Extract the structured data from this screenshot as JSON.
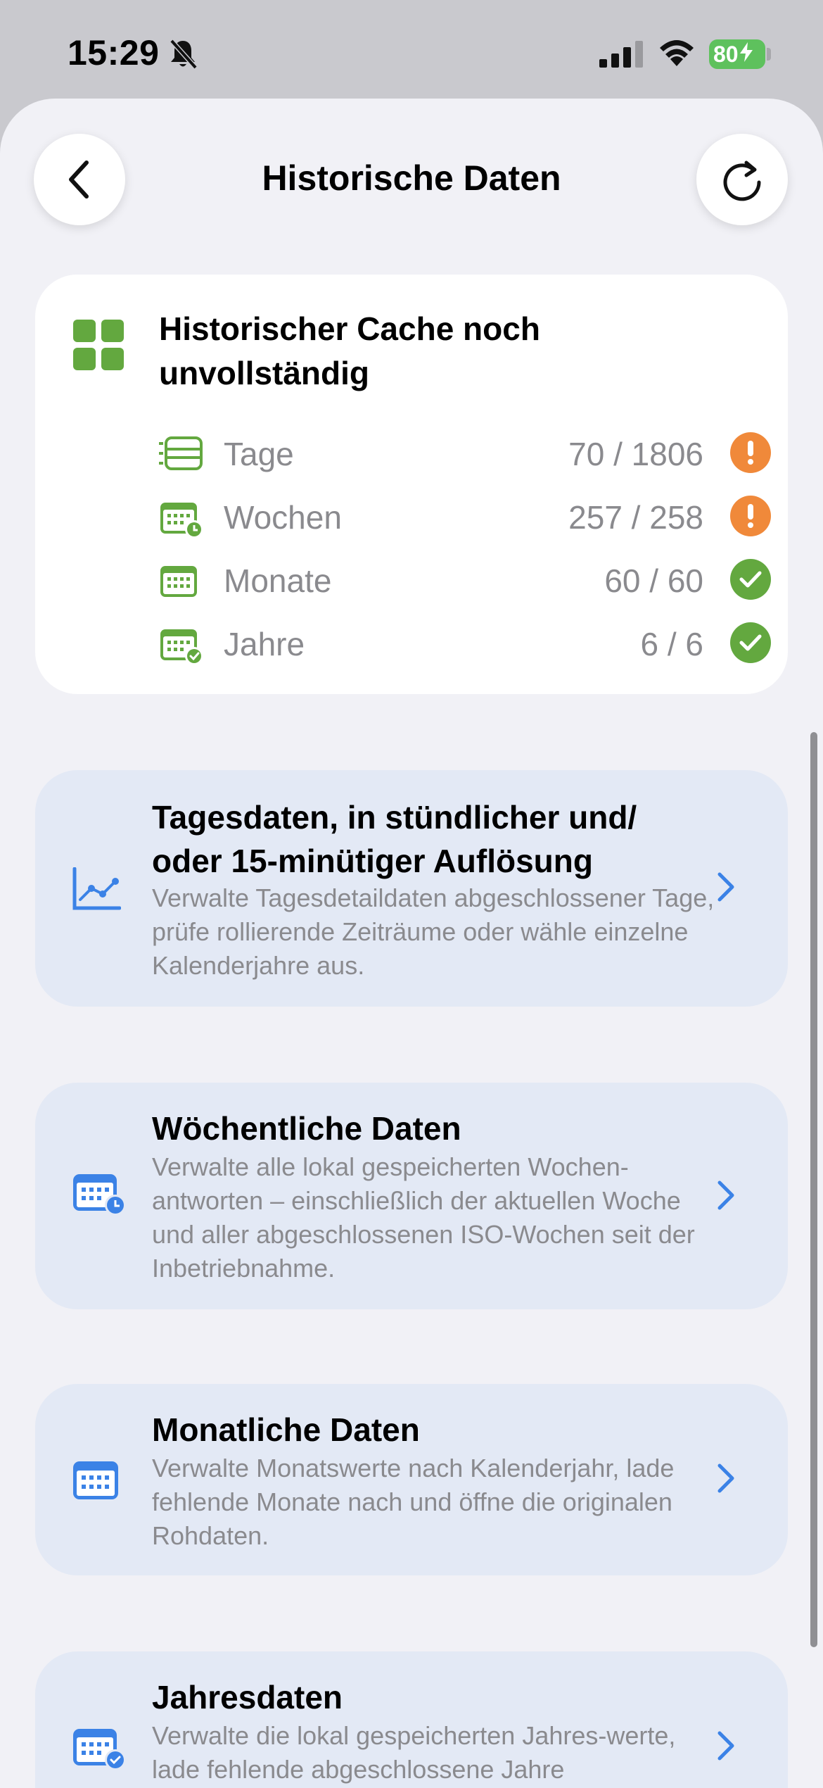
{
  "status_bar": {
    "time": "15:29",
    "battery": "80"
  },
  "nav": {
    "title": "Historische Daten"
  },
  "cache": {
    "title": "Historischer Cache noch unvollständig",
    "rows": [
      {
        "label": "Tage",
        "value": "70 / 1806",
        "status": "warning"
      },
      {
        "label": "Wochen",
        "value": "257 / 258",
        "status": "warning"
      },
      {
        "label": "Monate",
        "value": "60 / 60",
        "status": "ok"
      },
      {
        "label": "Jahre",
        "value": "6 / 6",
        "status": "ok"
      }
    ]
  },
  "sections": [
    {
      "title": "Tagesdaten, in stündlicher und/\noder 15-minütiger Auflösung",
      "description": "Verwalte Tagesdetaildaten abgeschlossener Tage, prüfe rollierende Zeiträume oder wähle einzelne Kalenderjahre aus.",
      "icon": "line-chart-icon"
    },
    {
      "title": "Wöchentliche Daten",
      "description": "Verwalte alle lokal gespeicherten Wochen-antworten – einschließlich der aktuellen Woche und aller abgeschlossenen ISO-Wochen seit der Inbetriebnahme.",
      "icon": "calendar-clock-icon"
    },
    {
      "title": "Monatliche Daten",
      "description": "Verwalte Monatswerte nach Kalenderjahr, lade fehlende Monate nach und öffne die originalen Rohdaten.",
      "icon": "calendar-icon"
    },
    {
      "title": "Jahresdaten",
      "description": "Verwalte die lokal gespeicherten Jahres-werte, lade fehlende abgeschlossene Jahre",
      "icon": "calendar-check-icon"
    }
  ],
  "colors": {
    "green": "#63a83f",
    "orange": "#f0893a",
    "blue": "#3b82e6",
    "card_blue": "#e3e9f5",
    "gray_text": "#8a8a8e"
  }
}
